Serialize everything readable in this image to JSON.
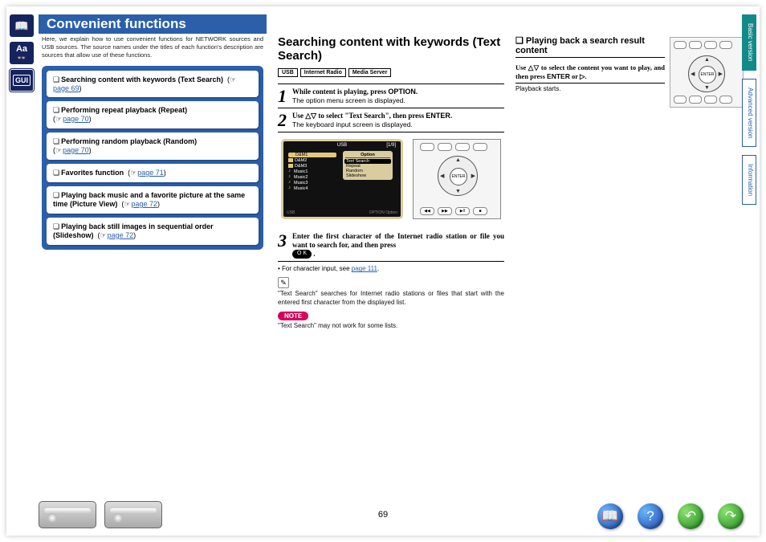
{
  "title_bar": "Convenient functions",
  "intro": "Here, we explain how to use convenient functions for NETWORK sources and USB sources. The source names under the titles of each function's description are sources that allow use of these functions.",
  "toc": [
    {
      "title": "Searching content with keywords (Text Search)",
      "link": "page 69"
    },
    {
      "title": "Performing repeat playback (Repeat)",
      "link": "page 70"
    },
    {
      "title": "Performing random playback (Random)",
      "link": "page 70"
    },
    {
      "title": "Favorites function",
      "link": "page 71"
    },
    {
      "title": "Playing back music and a favorite picture at the same time (Picture View)",
      "link": "page 72"
    },
    {
      "title": "Playing back still images in sequential order (Slideshow)",
      "link": "page 72"
    }
  ],
  "mid": {
    "heading": "Searching content with keywords (Text Search)",
    "tags": [
      "USB",
      "Internet Radio",
      "Media Server"
    ],
    "step1_main": "While content is playing, press ",
    "step1_bold": "OPTION",
    "step1_end": ".",
    "step1_sub": "The option menu screen is displayed.",
    "step2_main_a": "Use ",
    "step2_main_b": " to select \"Text Search\", then press ",
    "step2_bold": "ENTER",
    "step2_end": ".",
    "step2_sub": "The keyboard input screen is displayed.",
    "tv_title": "USB",
    "tv_count": "[1/9]",
    "tv_list": [
      "D&M1",
      "D&M2",
      "D&M3",
      "Music1",
      "Music2",
      "Music3",
      "Music4"
    ],
    "tv_popup_header": "Option",
    "tv_popup": [
      "Text Search",
      "Repeat",
      "Random",
      "Slideshow"
    ],
    "tv_bottom_left": "USB",
    "tv_bottom_right": "OPTION Option",
    "dpad_center": "ENTER",
    "step3_main": "Enter the first character of the Internet radio station or file you want to search for, and then press ",
    "ok_label": "O K",
    "step3_end": " .",
    "bullet": "For character input, see ",
    "bullet_link": "page 111",
    "bullet_end": ".",
    "tip": "\"Text Search\" searches for Internet radio stations or files that start with the entered first character from the displayed list.",
    "note_label": "NOTE",
    "note_text": "\"Text Search\" may not work for some lists."
  },
  "right": {
    "sub_h_prefix": "❏ ",
    "sub_h": "Playing back a search result content",
    "instr_a": "Use ",
    "instr_b": " to select the content you want to play, and then press ",
    "instr_bold": "ENTER",
    "instr_c": " or ",
    "instr_end": ".",
    "instr_sub": "Playback starts.",
    "dpad_center": "ENTER"
  },
  "side_tabs": [
    "Basic version",
    "Advanced version",
    "Information"
  ],
  "page_number": "69",
  "rail_icons": {
    "book": "📖",
    "aa": "Aa",
    "mask": "👓",
    "gui": "GUI"
  },
  "nav_glyphs": {
    "book": "📖",
    "help": "?",
    "back": "↶",
    "fwd": "↷"
  },
  "triangles": {
    "up": "△",
    "down": "▽",
    "right": "▷"
  }
}
